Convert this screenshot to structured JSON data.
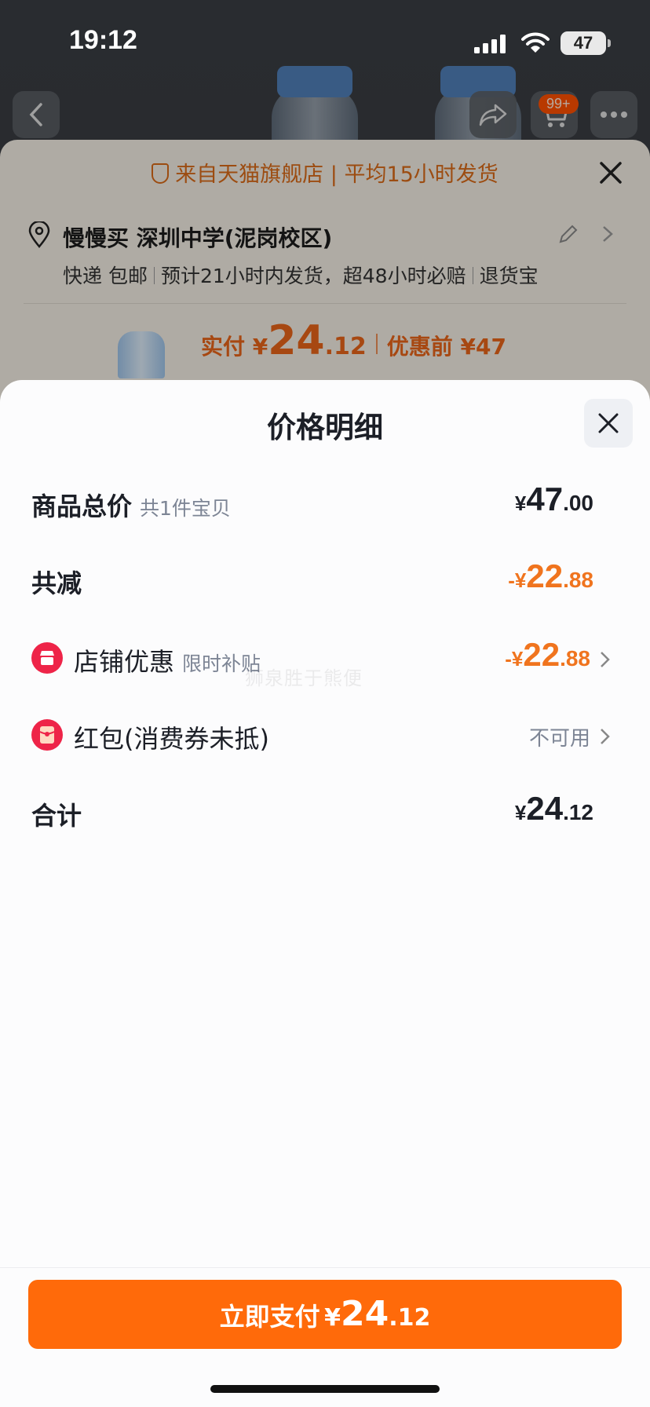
{
  "status_bar": {
    "time": "19:12",
    "battery": "47"
  },
  "product_page": {
    "cart_badge": "99+",
    "order_sheet": {
      "shop_notice": "来自天猫旗舰店 | 平均15小时发货",
      "address_name": "慢慢买 深圳中学(泥岗校区)",
      "delivery": [
        "快递 包邮",
        "预计21小时内发货，超48小时必赔",
        "退货宝"
      ],
      "pay_label": "实付 ¥",
      "pay_int": "24",
      "pay_dec": ".12",
      "original_price": "优惠前 ¥47"
    }
  },
  "price_detail": {
    "title": "价格明细",
    "watermark": "狮泉胜于熊便",
    "rows": [
      {
        "label": "商品总价",
        "sub": "共1件宝贝",
        "currency": "¥",
        "int": "47",
        "dec": ".00"
      },
      {
        "label": "共减",
        "currency": "-¥",
        "int": "22",
        "dec": ".88"
      },
      {
        "label": "店铺优惠",
        "sub": "限时补贴",
        "currency": "-¥",
        "int": "22",
        "dec": ".88",
        "icon": "shop-icon"
      },
      {
        "label": "红包(消费券未抵)",
        "status": "不可用",
        "icon": "red-packet-icon"
      },
      {
        "label": "合计",
        "currency": "¥",
        "int": "24",
        "dec": ".12"
      }
    ],
    "pay_button": {
      "label": "立即支付",
      "currency": "¥",
      "int": "24",
      "dec": ".12"
    }
  },
  "colors": {
    "accent": "#ff6a0a",
    "discount": "#f0741e",
    "shop_icon": "#ee2448"
  }
}
